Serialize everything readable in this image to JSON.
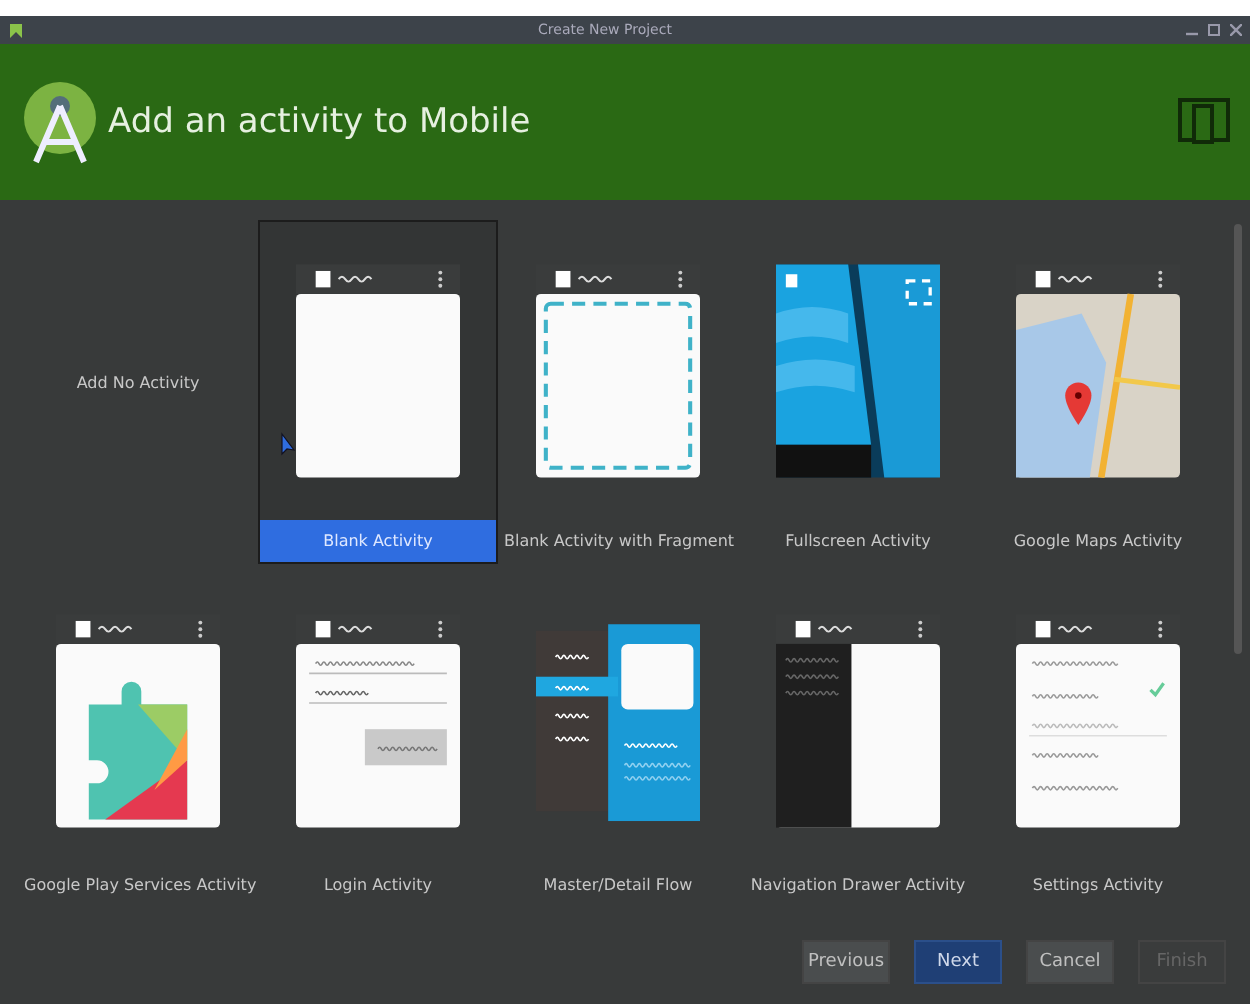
{
  "window": {
    "title": "Create New Project"
  },
  "header": {
    "title": "Add an activity to Mobile"
  },
  "templates": [
    {
      "label": "Add No Activity",
      "kind": "none",
      "selected": false
    },
    {
      "label": "Blank Activity",
      "kind": "blank",
      "selected": true
    },
    {
      "label": "Blank Activity with Fragment",
      "kind": "fragment",
      "selected": false
    },
    {
      "label": "Fullscreen Activity",
      "kind": "fullscreen",
      "selected": false
    },
    {
      "label": "Google Maps Activity",
      "kind": "maps",
      "selected": false
    },
    {
      "label": "Google Play Services Activity",
      "kind": "play",
      "selected": false
    },
    {
      "label": "Login Activity",
      "kind": "login",
      "selected": false
    },
    {
      "label": "Master/Detail Flow",
      "kind": "masterdetail",
      "selected": false
    },
    {
      "label": "Navigation Drawer Activity",
      "kind": "drawer",
      "selected": false
    },
    {
      "label": "Settings Activity",
      "kind": "settings",
      "selected": false
    }
  ],
  "buttons": [
    {
      "label": "Previous",
      "default": false,
      "disabled": false
    },
    {
      "label": "Next",
      "default": true,
      "disabled": false
    },
    {
      "label": "Cancel",
      "default": false,
      "disabled": false
    },
    {
      "label": "Finish",
      "default": false,
      "disabled": true
    }
  ]
}
